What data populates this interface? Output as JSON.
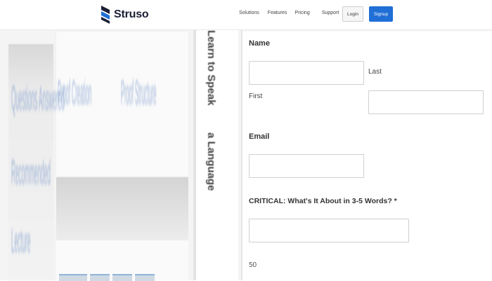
{
  "header": {
    "logo_text": "Struso",
    "nav": [
      "Solutions",
      "Features",
      "Pricing",
      "Support"
    ],
    "login_label": "Login",
    "signup_label": "Signup"
  },
  "preview": {
    "blur_texts": [
      "Questions Answered",
      "Recommended",
      "Lecture",
      "Proof Creation",
      "Proof Structure",
      "Learn to Speak",
      "a Language"
    ]
  },
  "form": {
    "name_label": "Name",
    "first_label": "First",
    "last_label": "Last",
    "first_value": "",
    "last_value": "",
    "email_label": "Email",
    "email_value": "",
    "critical_label": "CRITICAL: What's It About in 3-5 Words? *",
    "critical_value": "",
    "char_counter": "50"
  },
  "colors": {
    "accent": "#1f6fd6",
    "logo_dark": "#1a1f36",
    "logo_blue": "#1f6fd6"
  }
}
